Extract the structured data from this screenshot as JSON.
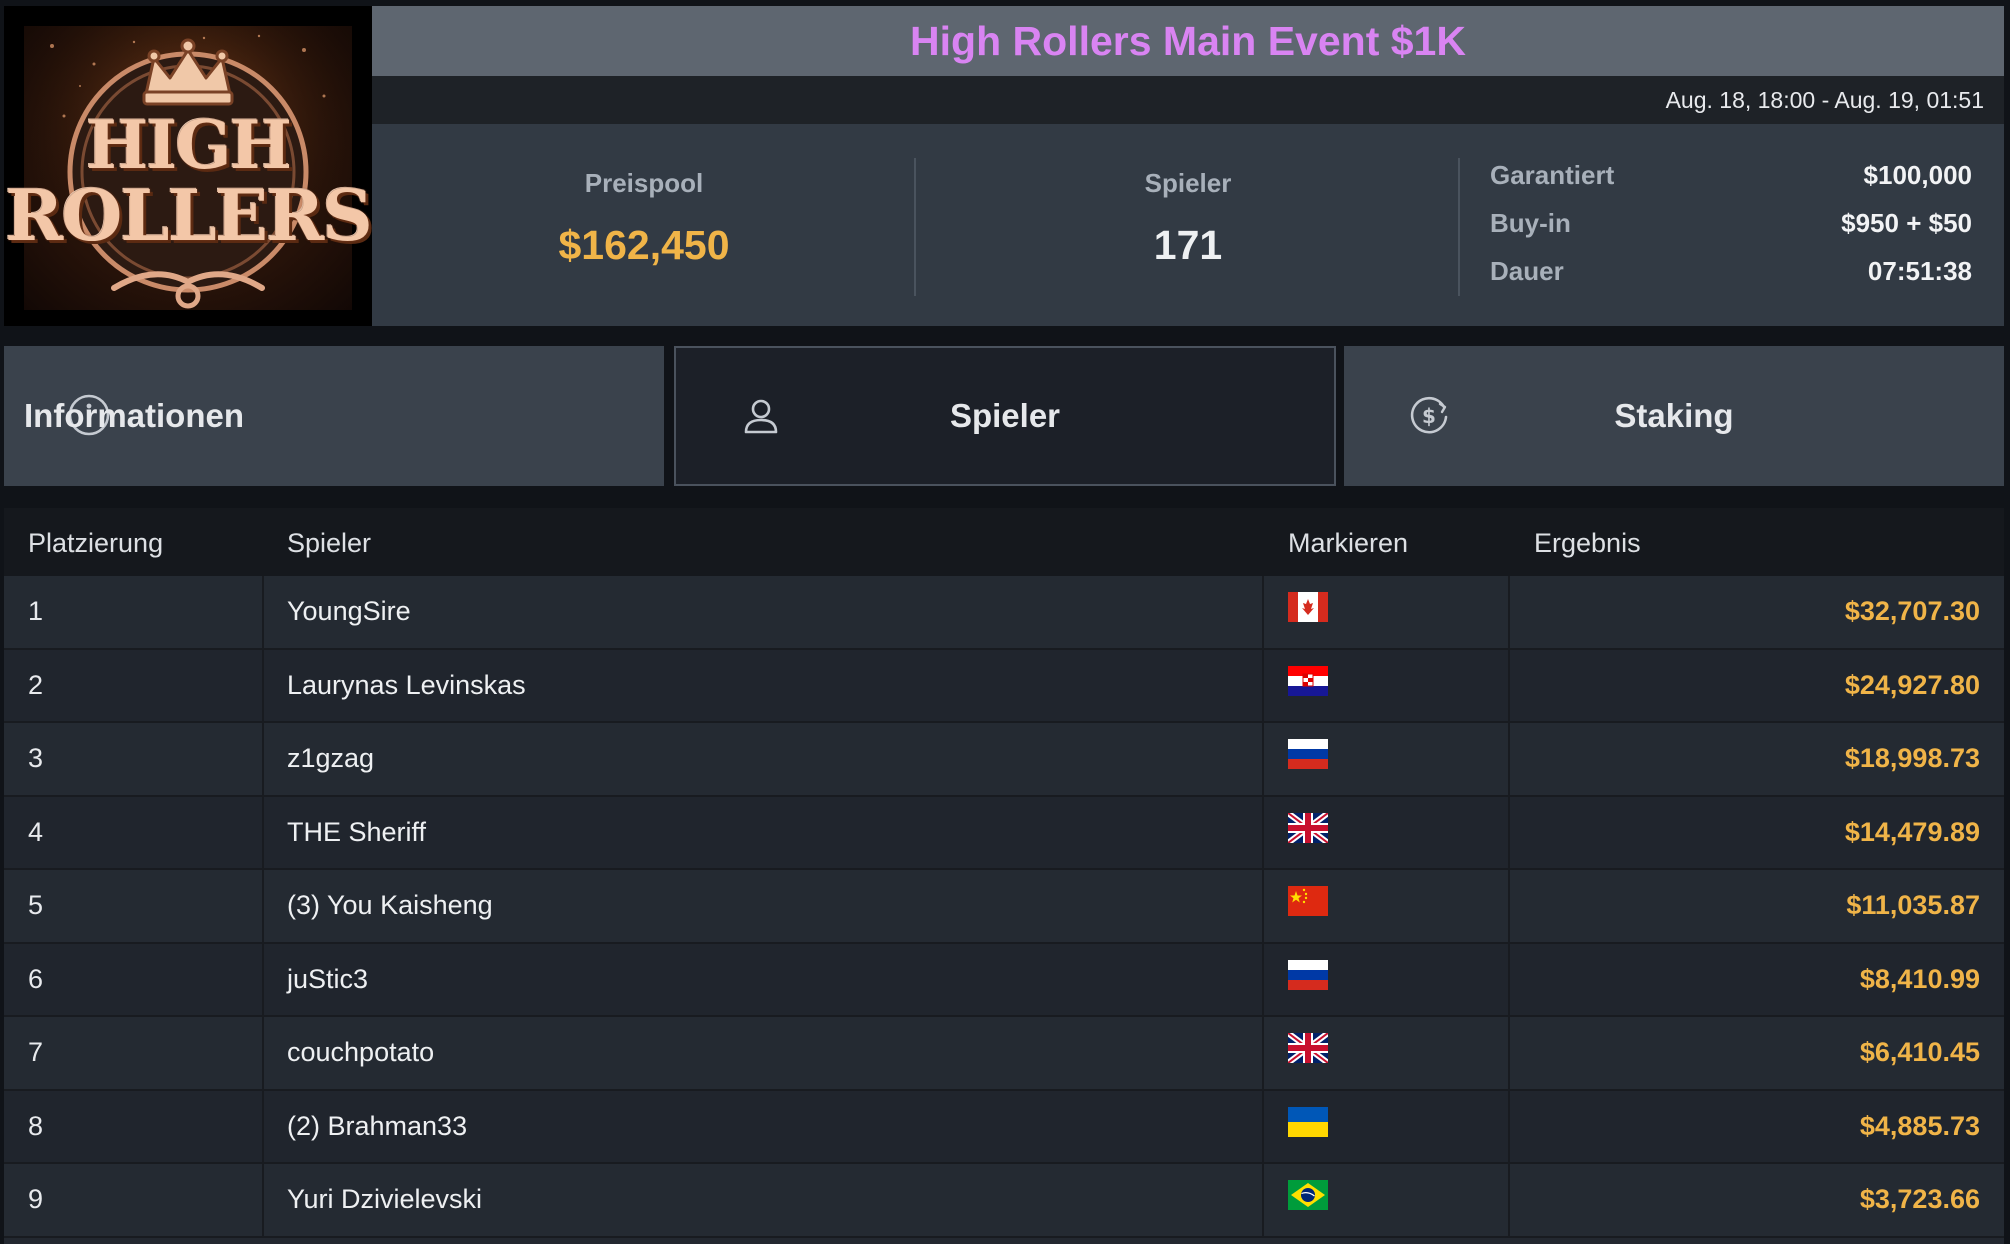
{
  "event": {
    "logo_line1": "HIGH",
    "logo_line2": "ROLLERS",
    "title": "High Rollers Main Event $1K",
    "dates": "Aug. 18, 18:00 - Aug. 19, 01:51"
  },
  "stats": {
    "pool_label": "Preispool",
    "pool_value": "$162,450",
    "players_label": "Spieler",
    "players_value": "171",
    "details": [
      {
        "key": "Garantiert",
        "value": "$100,000"
      },
      {
        "key": "Buy-in",
        "value": "$950 + $50"
      },
      {
        "key": "Dauer",
        "value": "07:51:38"
      }
    ]
  },
  "tabs": [
    {
      "label": "Informationen",
      "icon": "info-icon",
      "active": false
    },
    {
      "label": "Spieler",
      "icon": "user-icon",
      "active": true
    },
    {
      "label": "Staking",
      "icon": "dollar-coin-icon",
      "active": false
    }
  ],
  "table": {
    "headers": [
      "Platzierung",
      "Spieler",
      "Markieren",
      "Ergebnis"
    ],
    "rows": [
      {
        "rank": "1",
        "player": "YoungSire",
        "flag": "CA",
        "result": "$32,707.30"
      },
      {
        "rank": "2",
        "player": "Laurynas Levinskas",
        "flag": "HR",
        "result": "$24,927.80"
      },
      {
        "rank": "3",
        "player": "z1gzag",
        "flag": "RU",
        "result": "$18,998.73"
      },
      {
        "rank": "4",
        "player": "THE Sheriff",
        "flag": "GB",
        "result": "$14,479.89"
      },
      {
        "rank": "5",
        "player": "(3) You Kaisheng",
        "flag": "CN",
        "result": "$11,035.87"
      },
      {
        "rank": "6",
        "player": "juStic3",
        "flag": "RU",
        "result": "$8,410.99"
      },
      {
        "rank": "7",
        "player": "couchpotato",
        "flag": "GB",
        "result": "$6,410.45"
      },
      {
        "rank": "8",
        "player": "(2) Brahman33",
        "flag": "UA",
        "result": "$4,885.73"
      },
      {
        "rank": "9",
        "player": "Yuri Dzivielevski",
        "flag": "BR",
        "result": "$3,723.66"
      }
    ]
  },
  "colors": {
    "title": "#d984f2",
    "gold": "#f0b448"
  }
}
